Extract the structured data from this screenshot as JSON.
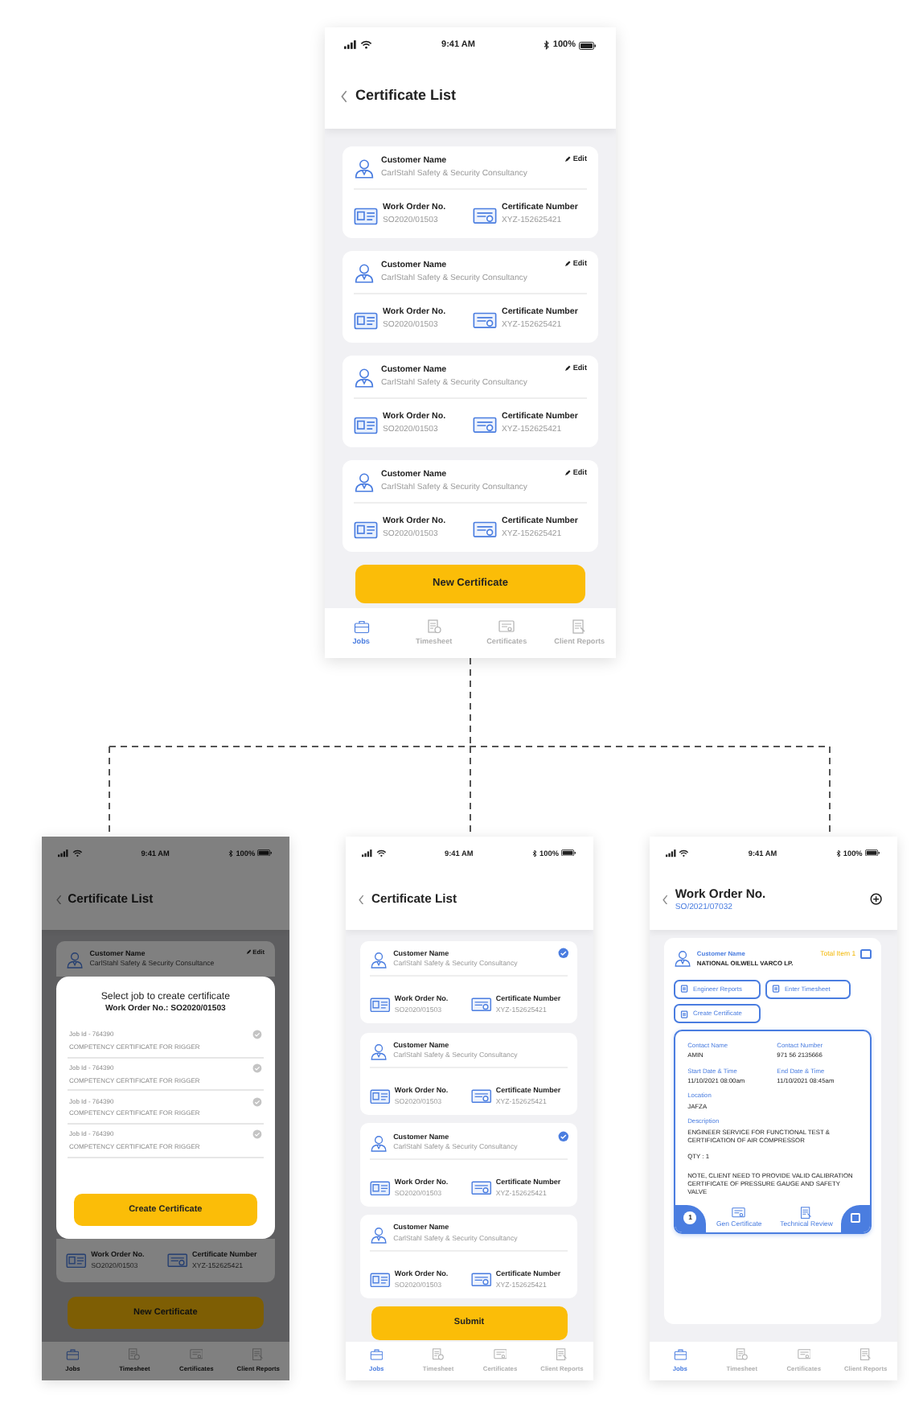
{
  "screens": [
    {
      "kind": "list",
      "status": {
        "time": "9:41 AM",
        "battery": "100%"
      },
      "title": "Certificate List",
      "cards": [
        {
          "customer_label": "Customer Name",
          "customer": "CarlStahl Safety & Security Consultancy",
          "edit": "Edit",
          "work_order_label": "Work Order No.",
          "work_order": "SO2020/01503",
          "cert_label": "Certificate Number",
          "cert": "XYZ-152625421"
        },
        {
          "customer_label": "Customer Name",
          "customer": "CarlStahl Safety & Security Consultancy",
          "edit": "Edit",
          "work_order_label": "Work Order No.",
          "work_order": "SO2020/01503",
          "cert_label": "Certificate Number",
          "cert": "XYZ-152625421"
        },
        {
          "customer_label": "Customer Name",
          "customer": "CarlStahl Safety & Security Consultancy",
          "edit": "Edit",
          "work_order_label": "Work Order No.",
          "work_order": "SO2020/01503",
          "cert_label": "Certificate Number",
          "cert": "XYZ-152625421"
        },
        {
          "customer_label": "Customer Name",
          "customer": "CarlStahl Safety & Security Consultancy",
          "edit": "Edit",
          "work_order_label": "Work Order No.",
          "work_order": "SO2020/01503",
          "cert_label": "Certificate Number",
          "cert": "XYZ-152625421"
        }
      ],
      "button": "New Certificate",
      "tabs": [
        {
          "label": "Jobs",
          "selected": true
        },
        {
          "label": "Timesheet",
          "selected": false
        },
        {
          "label": "Certificates",
          "selected": false
        },
        {
          "label": "Client Reports",
          "selected": false
        }
      ]
    },
    {
      "kind": "modal",
      "status": {
        "time": "9:41 AM",
        "battery": "100%"
      },
      "title": "Certificate List",
      "behind_top": {
        "customer_label": "Customer Name",
        "customer": "CarlStahl Safety & Security Consultance",
        "edit": "Edit"
      },
      "modal": {
        "title": "Select job to create certificate",
        "subtitle": "Work Order No.: SO2020/01503",
        "jobs": [
          {
            "job_id": "Job Id - 764390",
            "description": "COMPETENCY CERTIFICATE FOR RIGGER",
            "checked": false
          },
          {
            "job_id": "Job Id - 764390",
            "description": "COMPETENCY CERTIFICATE FOR RIGGER",
            "checked": false
          },
          {
            "job_id": "Job Id - 764390",
            "description": "COMPETENCY CERTIFICATE FOR RIGGER",
            "checked": false
          },
          {
            "job_id": "Job Id - 764390",
            "description": "COMPETENCY CERTIFICATE FOR RIGGER",
            "checked": false
          }
        ],
        "button": "Create Certificate"
      },
      "behind_bottom": {
        "work_order_label": "Work Order No.",
        "work_order": "SO2020/01503",
        "cert_label": "Certificate Number",
        "cert": "XYZ-152625421"
      },
      "button": "New Certificate",
      "tabs": [
        {
          "label": "Jobs",
          "selected": true
        },
        {
          "label": "Timesheet",
          "selected": false
        },
        {
          "label": "Certificates",
          "selected": false
        },
        {
          "label": "Client Reports",
          "selected": false
        }
      ]
    },
    {
      "kind": "select",
      "status": {
        "time": "9:41 AM",
        "battery": "100%"
      },
      "title": "Certificate List",
      "cards": [
        {
          "customer_label": "Customer Name",
          "customer": "CarlStahl Safety & Security Consultancy",
          "selected": true,
          "work_order_label": "Work Order No.",
          "work_order": "SO2020/01503",
          "cert_label": "Certificate Number",
          "cert": "XYZ-152625421"
        },
        {
          "customer_label": "Customer Name",
          "customer": "CarlStahl Safety & Security Consultancy",
          "selected": false,
          "work_order_label": "Work Order No.",
          "work_order": "SO2020/01503",
          "cert_label": "Certificate Number",
          "cert": "XYZ-152625421"
        },
        {
          "customer_label": "Customer Name",
          "customer": "CarlStahl Safety & Security Consultancy",
          "selected": true,
          "work_order_label": "Work Order No.",
          "work_order": "SO2020/01503",
          "cert_label": "Certificate Number",
          "cert": "XYZ-152625421"
        },
        {
          "customer_label": "Customer Name",
          "customer": "CarlStahl Safety & Security Consultancy",
          "selected": false,
          "work_order_label": "Work Order No.",
          "work_order": "SO2020/01503",
          "cert_label": "Certificate Number",
          "cert": "XYZ-152625421"
        }
      ],
      "button": "Submit",
      "tabs": [
        {
          "label": "Jobs",
          "selected": true
        },
        {
          "label": "Timesheet",
          "selected": false
        },
        {
          "label": "Certificates",
          "selected": false
        },
        {
          "label": "Client Reports",
          "selected": false
        }
      ]
    },
    {
      "kind": "detail",
      "status": {
        "time": "9:41 AM",
        "battery": "100%"
      },
      "title": "Work Order No.",
      "subtitle": "SO/2021/07032",
      "customer_label": "Customer Name",
      "customer": "NATIONAL OILWELL VARCO LP.",
      "total": "Total Item 1",
      "total_checked": false,
      "actions": [
        "Engineer Reports",
        "Enter Timesheet",
        "Create Certificate"
      ],
      "fields": [
        {
          "label": "Contact Name",
          "value": "AMIN"
        },
        {
          "label": "Contact Number",
          "value": "971 56 2135666"
        },
        {
          "label": "Start Date & Time",
          "value": "11/10/2021 08:00am"
        },
        {
          "label": "End Date & Time",
          "value": "11/10/2021 08:45am"
        },
        {
          "label": "Location",
          "value": "JAFZA"
        }
      ],
      "description_label": "Description",
      "description": [
        "ENGINEER SERVICE FOR FUNCTIONAL TEST & CERTIFICATION OF AIR COMPRESSOR",
        "QTY : 1",
        "NOTE, CLIENT NEED TO PROVIDE VALID CALIBRATION CERTIFICATE OF PRESSURE GAUGE AND SAFETY VALVE"
      ],
      "badge": "1",
      "footer_actions": [
        "Gen Certificate",
        "Technical Review"
      ],
      "footer_checked": false,
      "tabs": [
        {
          "label": "Jobs",
          "selected": true
        },
        {
          "label": "Timesheet",
          "selected": false
        },
        {
          "label": "Certificates",
          "selected": false
        },
        {
          "label": "Client Reports",
          "selected": false
        }
      ]
    }
  ]
}
